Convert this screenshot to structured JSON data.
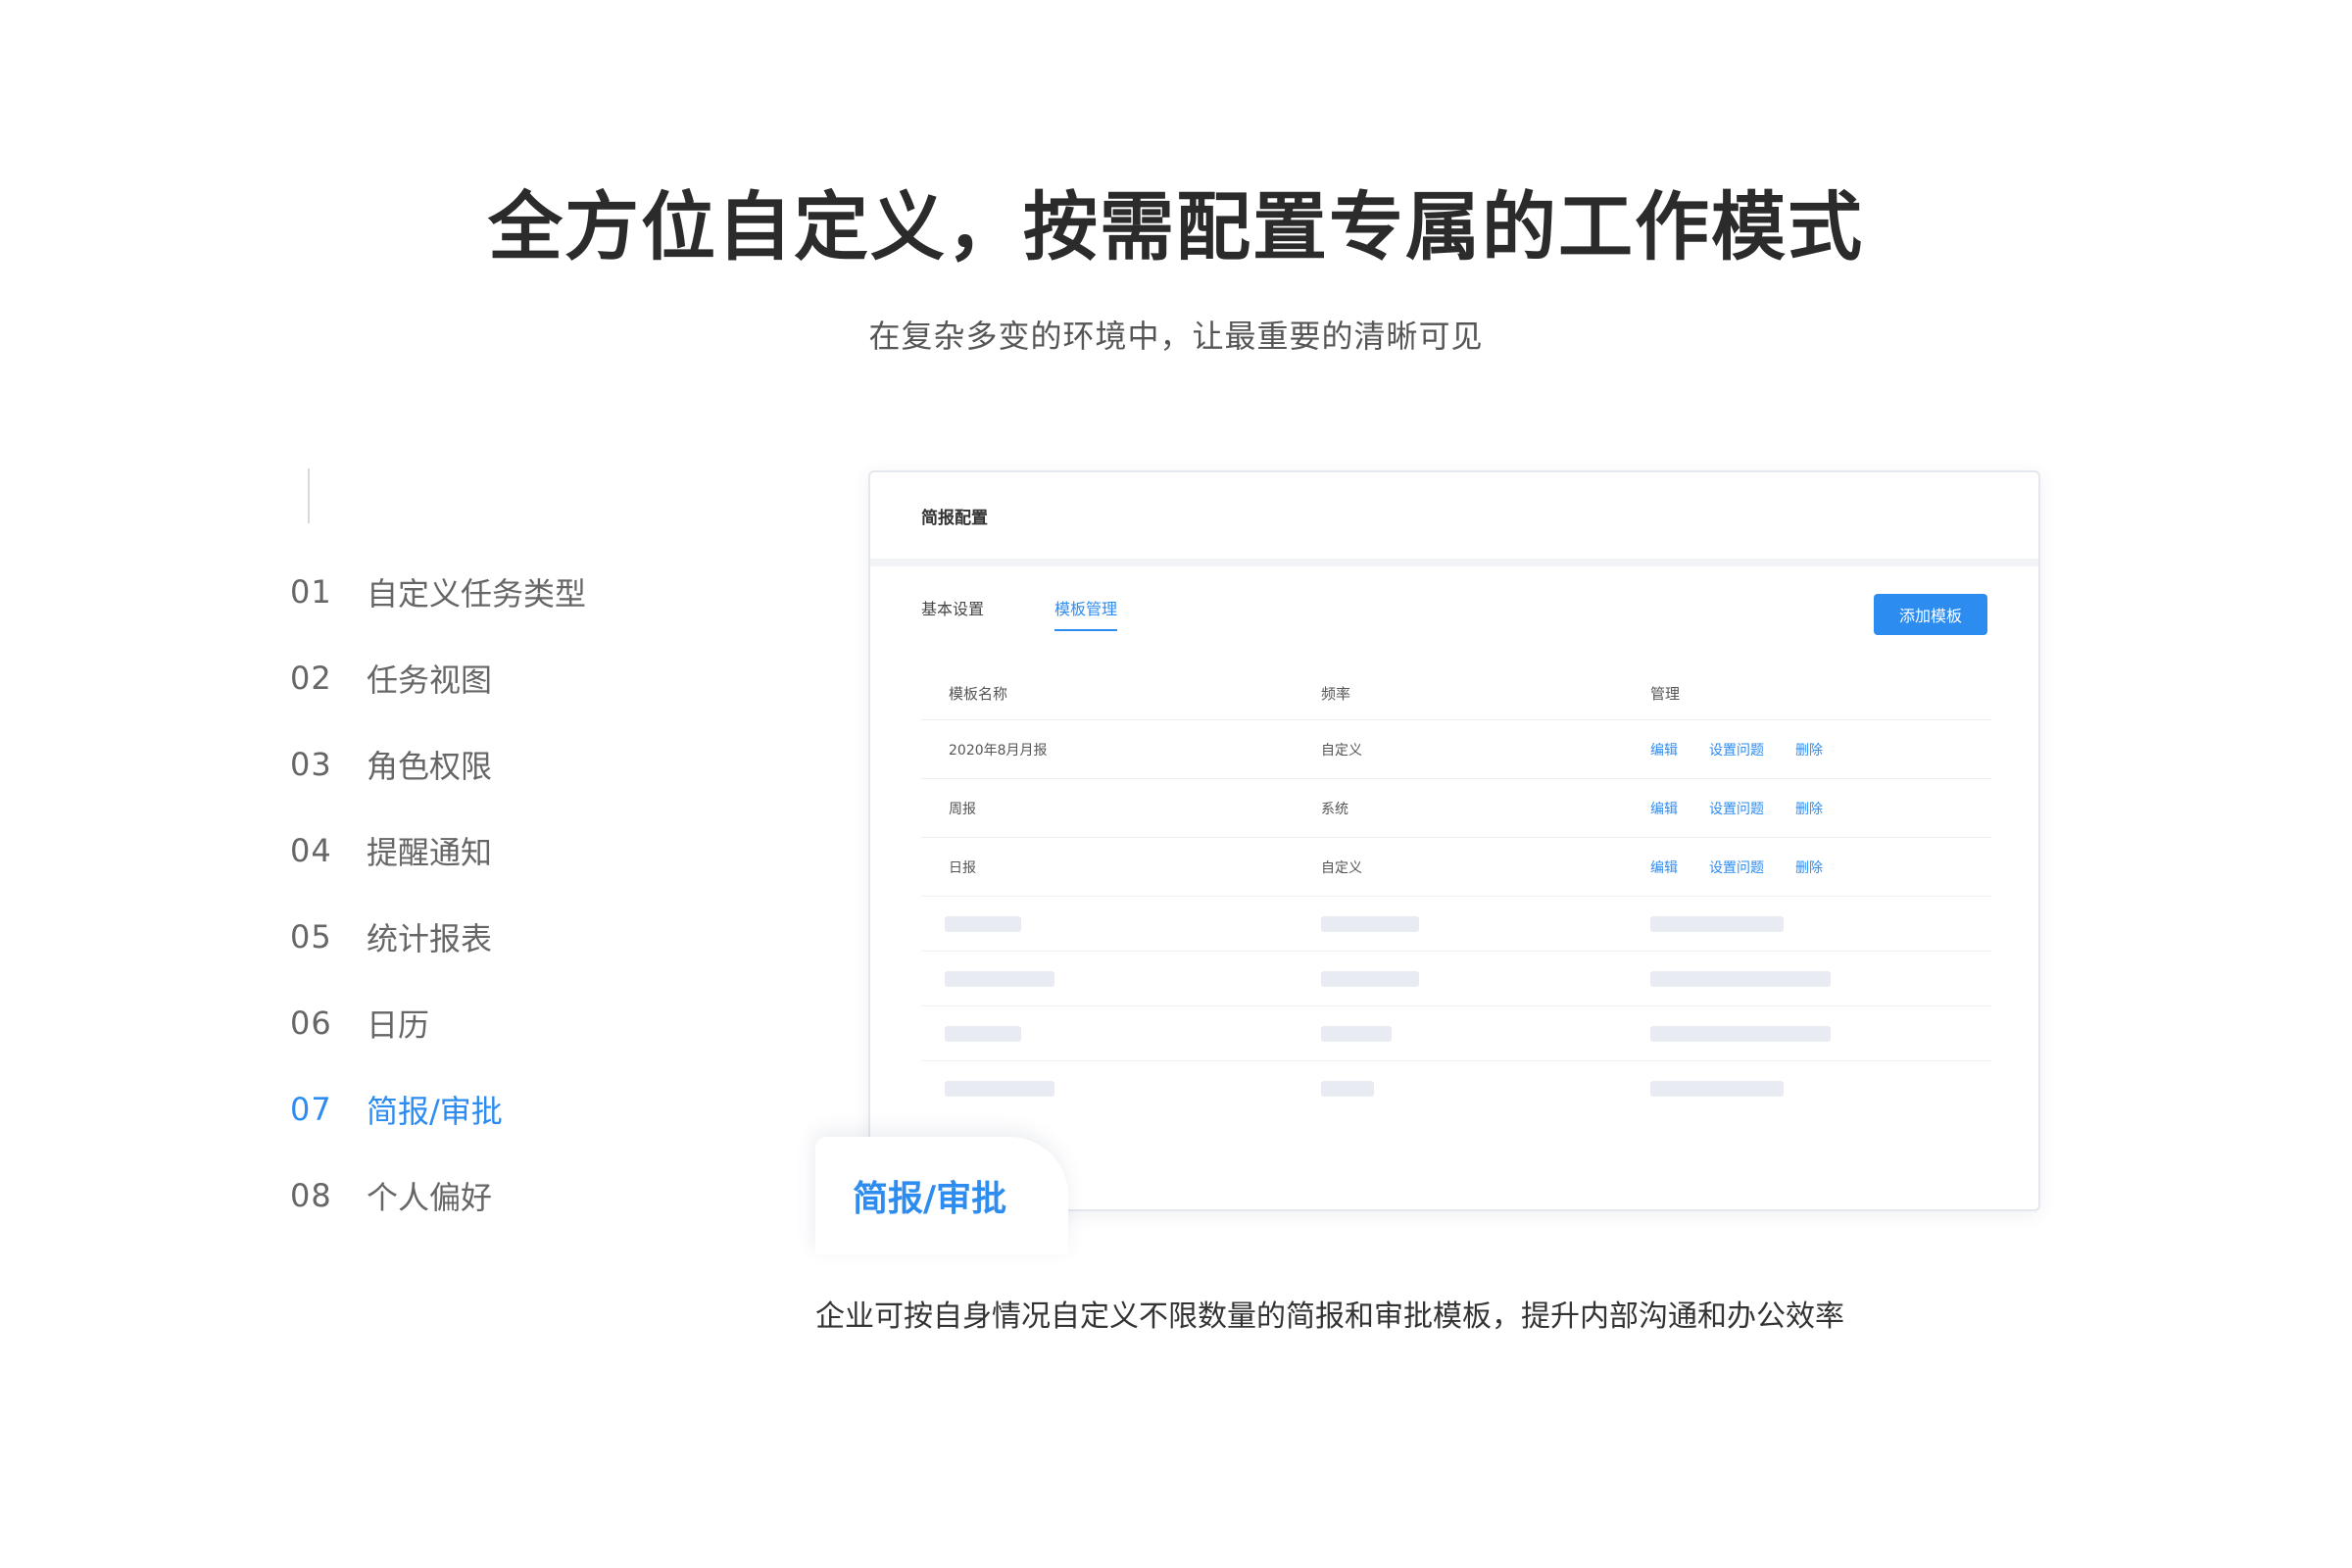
{
  "hero": {
    "title": "全方位自定义，按需配置专属的工作模式",
    "subtitle": "在复杂多变的环境中，让最重要的清晰可见"
  },
  "feature_nav": {
    "items": [
      {
        "num": "01",
        "label": "自定义任务类型"
      },
      {
        "num": "02",
        "label": "任务视图"
      },
      {
        "num": "03",
        "label": "角色权限"
      },
      {
        "num": "04",
        "label": "提醒通知"
      },
      {
        "num": "05",
        "label": "统计报表"
      },
      {
        "num": "06",
        "label": "日历"
      },
      {
        "num": "07",
        "label": "简报/审批"
      },
      {
        "num": "08",
        "label": "个人偏好"
      }
    ],
    "active_index": 6
  },
  "panel": {
    "title": "简报配置",
    "tabs": [
      "基本设置",
      "模板管理"
    ],
    "active_tab": 1,
    "add_button": "添加模板",
    "table": {
      "headers": [
        "模板名称",
        "频率",
        "管理"
      ],
      "rows": [
        {
          "name": "2020年8月月报",
          "frequency": "自定义",
          "actions": [
            "编辑",
            "设置问题",
            "删除"
          ]
        },
        {
          "name": "周报",
          "frequency": "系统",
          "actions": [
            "编辑",
            "设置问题",
            "删除"
          ]
        },
        {
          "name": "日报",
          "frequency": "自定义",
          "actions": [
            "编辑",
            "设置问题",
            "删除"
          ]
        }
      ]
    }
  },
  "feature_card": {
    "label": "简报/审批"
  },
  "description": "企业可按自身情况自定义不限数量的简报和审批模板，提升内部沟通和办公效率",
  "colors": {
    "accent": "#2d8cf0",
    "text": "#333333",
    "muted": "#666666",
    "skeleton": "#e8ebf2"
  }
}
